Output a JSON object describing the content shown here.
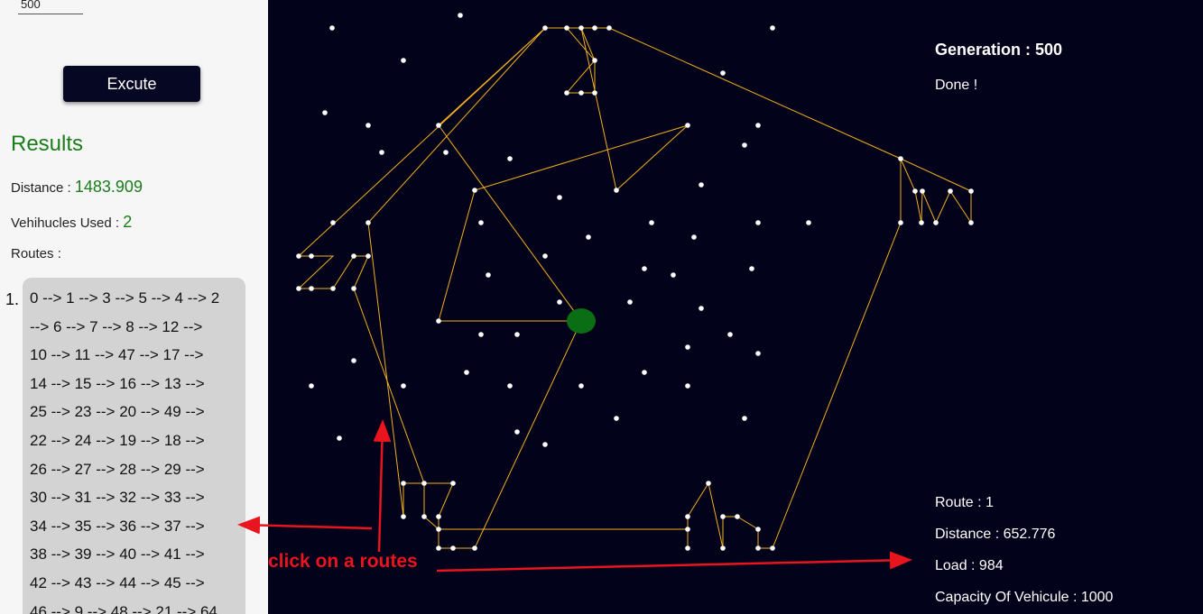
{
  "controls": {
    "generations_value": "500",
    "execute_label": "Excute"
  },
  "results": {
    "title": "Results",
    "distance_label": "Distance : ",
    "distance_value": "1483.909",
    "vehicles_label": "Vehihucles Used : ",
    "vehicles_value": "2",
    "routes_label": "Routes :",
    "route_index": "1.",
    "route_lines": [
      "0 --> 1 --> 3 --> 5 --> 4 --> 2",
      "--> 6 --> 7 --> 8 --> 12 -->",
      "10 --> 11 --> 47 --> 17 -->",
      "14 --> 15 --> 16 --> 13 -->",
      "25 --> 23 --> 20 --> 49 -->",
      "22 --> 24 --> 19 --> 18 -->",
      "26 --> 27 --> 28 --> 29 -->",
      "30 --> 31 --> 32 --> 33 -->",
      "34 --> 35 --> 36 --> 37 -->",
      "38 --> 39 --> 40 --> 41 -->",
      "42 --> 43 --> 44 --> 45 -->",
      "46 --> 9 --> 48 --> 21 --> 64"
    ]
  },
  "visualization": {
    "generation_label": "Generation : ",
    "generation_value": "500",
    "status": "Done !",
    "route_info": {
      "route": "Route : 1",
      "distance": "Distance : 652.776",
      "load": "Load : 984",
      "capacity": "Capacity Of Vehicule : 1000"
    },
    "colors": {
      "background": "#02021a",
      "route_line": "#f0b020",
      "customer": "#ffffff",
      "depot": "#0a6e14"
    }
  },
  "annotation": {
    "text": "click on a routes",
    "color": "#e8141e"
  }
}
